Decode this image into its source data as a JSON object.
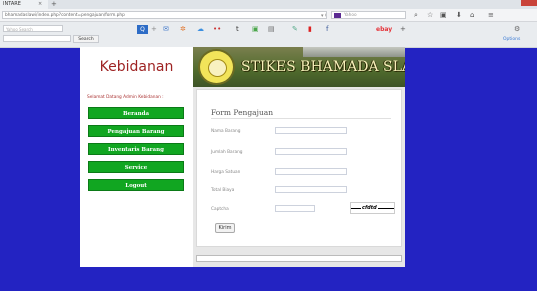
{
  "browser": {
    "tab_title": "INTARE",
    "tab_close": "×",
    "new_tab": "+",
    "url": "bhamadaslawi/index.php?content=pengajuan/form.php",
    "reload": "▾ C",
    "search_placeholder": "Yahoo",
    "search_engine_icon": "yahoo-icon",
    "nav_icons": [
      "search-icon",
      "star-icon",
      "reader-icon",
      "download-icon",
      "home-icon",
      "menu-icon"
    ]
  },
  "toolbar": {
    "side_search_placeholder": "Yahoo Search",
    "search_button": "Search",
    "ebay": "ebay",
    "options": "Options"
  },
  "site": {
    "left_title": "Kebidanan",
    "banner_title": "STIKES BHAMADA SLAWI",
    "welcome": "Selamat Datang Admin Kebidanan :",
    "menu": [
      {
        "label": "Beranda"
      },
      {
        "label": "Pengajuan Barang"
      },
      {
        "label": "Inventaris Barang"
      },
      {
        "label": "Service"
      },
      {
        "label": "Logout"
      }
    ]
  },
  "form": {
    "title": "Form Pengajuan",
    "fields": [
      {
        "label": "Nama Barang",
        "value": ""
      },
      {
        "label": "Jumlah Barang",
        "value": ""
      },
      {
        "label": "Harga Satuan",
        "value": ""
      },
      {
        "label": "Total Biaya",
        "value": ""
      },
      {
        "label": "Captcha",
        "value": ""
      }
    ],
    "captcha_text": "cfdtd",
    "submit": "Kirim"
  },
  "colors": {
    "page_bg": "#2323c2",
    "menu_green": "#11a621",
    "title_red": "#9e2323"
  }
}
